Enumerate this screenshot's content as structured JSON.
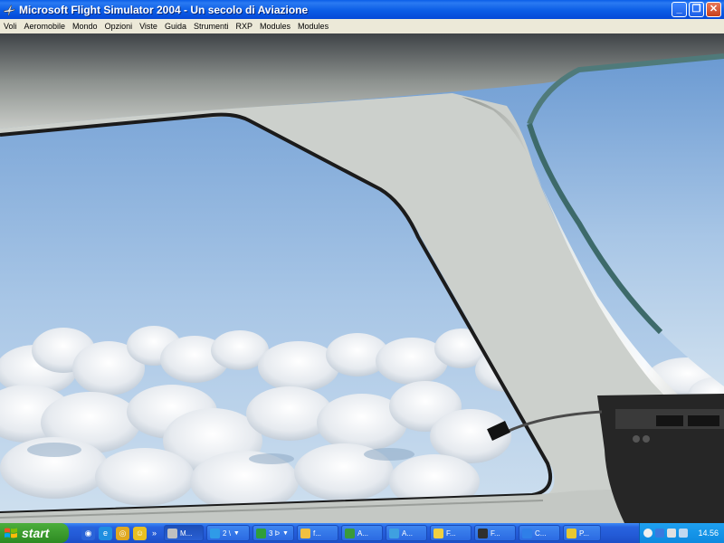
{
  "window": {
    "title": "Microsoft Flight Simulator 2004 - Un secolo di Aviazione",
    "buttons": {
      "minimize": "_",
      "maximize": "❐",
      "close": "✕"
    }
  },
  "menubar": {
    "items": [
      "Voli",
      "Aeromobile",
      "Mondo",
      "Opzioni",
      "Viste",
      "Guida",
      "Strumenti",
      "RXP",
      "Modules",
      "Modules"
    ]
  },
  "taskbar": {
    "start_label": "start",
    "quicklaunch_more": "»",
    "tasks": [
      {
        "label": "M...",
        "icon_color": "#c0c0c0",
        "active": true,
        "arrow": false
      },
      {
        "label": "2 \\",
        "icon_color": "#2f9be8",
        "active": false,
        "arrow": true
      },
      {
        "label": "3 Þ",
        "icon_color": "#2f9e3a",
        "active": false,
        "arrow": true
      },
      {
        "label": "f...",
        "icon_color": "#f0c040",
        "active": false,
        "arrow": false
      },
      {
        "label": "A...",
        "icon_color": "#3a9a3a",
        "active": false,
        "arrow": false
      },
      {
        "label": "A...",
        "icon_color": "#3fa0e0",
        "active": false,
        "arrow": false
      },
      {
        "label": "F...",
        "icon_color": "#f0d040",
        "active": false,
        "arrow": false
      },
      {
        "label": "F...",
        "icon_color": "#303030",
        "active": false,
        "arrow": false
      },
      {
        "label": "C...",
        "icon_color": "#2f7fe8",
        "active": false,
        "arrow": false
      },
      {
        "label": "P...",
        "icon_color": "#e8c830",
        "active": false,
        "arrow": false
      }
    ],
    "clock": "14.56"
  },
  "colors": {
    "sky_top": "#7fa9d8",
    "sky_bottom": "#bcd4ea",
    "cloud": "#f2f4f6",
    "frame": "#d7dbd6",
    "frame_edge": "#1e1e1e",
    "titlebar": "#0b5de6"
  }
}
